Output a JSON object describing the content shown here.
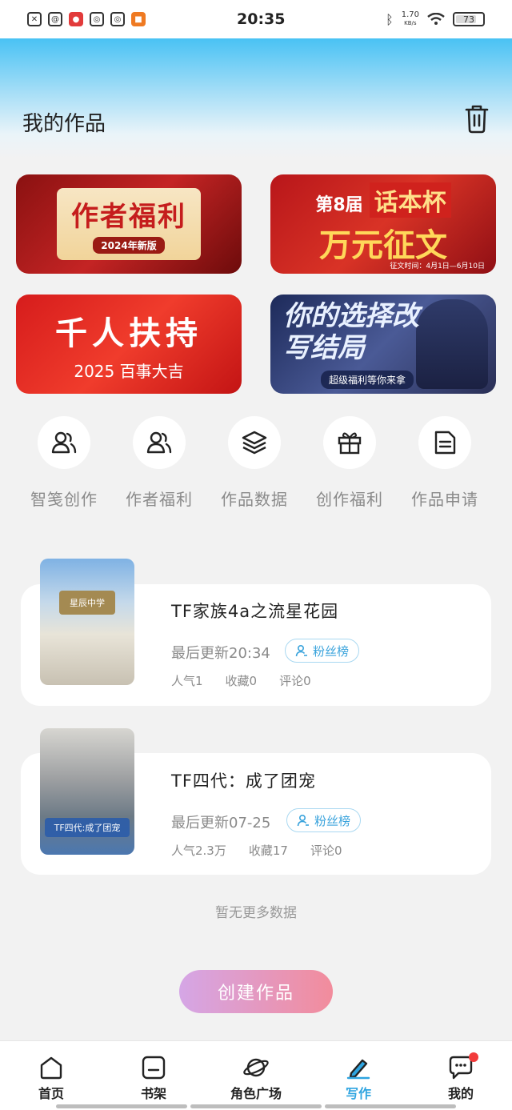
{
  "status_bar": {
    "time": "20:35",
    "net_speed": "1.70",
    "net_unit": "KB/s",
    "battery": "73",
    "left_icons": [
      "file-icon",
      "at-icon",
      "app-red-icon",
      "weibo-icon",
      "weibo-icon",
      "app-orange-icon"
    ]
  },
  "header": {
    "title": "我的作品"
  },
  "banners": [
    {
      "main": "作者福利",
      "sub": "2024年新版"
    },
    {
      "edition": "第8届",
      "cup": "话本杯",
      "main": "万元征文",
      "period": "征文时间：4月1日—6月10日"
    },
    {
      "main": "千人扶持",
      "sub": "2025 百事大吉"
    },
    {
      "main": "你的选择改写结局",
      "sub": "超级福利等你来拿"
    }
  ],
  "quick_actions": [
    {
      "label": "智笺创作",
      "icon": "users-icon"
    },
    {
      "label": "作者福利",
      "icon": "users-icon"
    },
    {
      "label": "作品数据",
      "icon": "layers-icon"
    },
    {
      "label": "创作福利",
      "icon": "gift-icon"
    },
    {
      "label": "作品申请",
      "icon": "document-icon"
    }
  ],
  "works": [
    {
      "title": "TF家族4a之流星花园",
      "updated": "最后更新20:34",
      "fans_label": "粉丝榜",
      "cover_text": "星辰中学",
      "popularity": "人气1",
      "favorites": "收藏0",
      "comments": "评论0"
    },
    {
      "title": "TF四代：成了团宠",
      "updated": "最后更新07-25",
      "fans_label": "粉丝榜",
      "cover_text": "TF四代:成了团宠",
      "popularity": "人气2.3万",
      "favorites": "收藏17",
      "comments": "评论0"
    }
  ],
  "no_more": "暂无更多数据",
  "create_button": "创建作品",
  "bottom_nav": [
    {
      "label": "首页",
      "icon": "home-icon",
      "active": false
    },
    {
      "label": "书架",
      "icon": "bookshelf-icon",
      "active": false
    },
    {
      "label": "角色广场",
      "icon": "planet-icon",
      "active": false
    },
    {
      "label": "写作",
      "icon": "pen-icon",
      "active": true
    },
    {
      "label": "我的",
      "icon": "chat-icon",
      "active": false,
      "badge": true
    }
  ],
  "colors": {
    "accent": "#2ea4e0",
    "header_gradient_top": "#49c2f4",
    "create_gradient_start": "#d5a6e6",
    "create_gradient_end": "#f28c9c",
    "badge": "#f23b3b"
  }
}
